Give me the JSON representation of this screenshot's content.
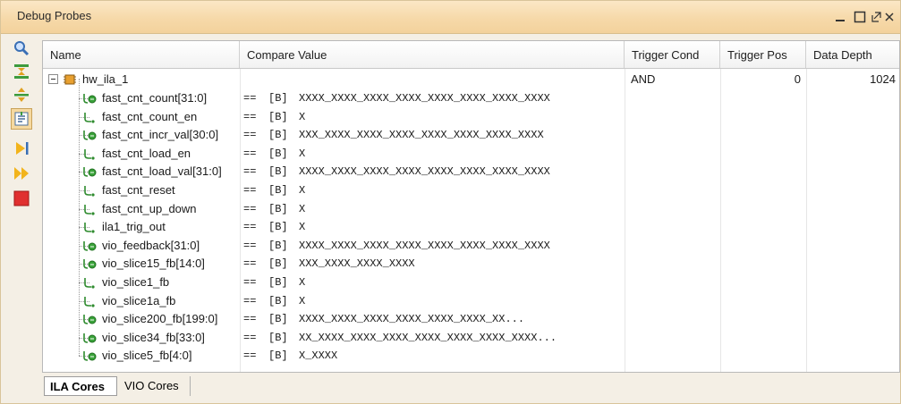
{
  "window": {
    "title": "Debug Probes",
    "controls": [
      "minimize-icon",
      "maximize-icon",
      "restore-icon",
      "close-icon"
    ]
  },
  "toolbar": {
    "buttons": [
      {
        "icon": "search-icon"
      },
      {
        "icon": "collapse-all-icon"
      },
      {
        "icon": "expand-all-icon"
      },
      {
        "icon": "probe-settings-icon",
        "active": true
      },
      {
        "icon": "run-trigger-icon"
      },
      {
        "icon": "run-trigger-immediate-icon"
      },
      {
        "icon": "stop-icon"
      }
    ]
  },
  "table": {
    "columns": [
      "Name",
      "Compare Value",
      "Trigger Cond",
      "Trigger Pos",
      "Data Depth"
    ],
    "core": {
      "name": "hw_ila_1",
      "trigger_cond": "AND",
      "trigger_pos": "0",
      "data_depth": "1024"
    },
    "probes": [
      {
        "name": "fast_cnt_count[31:0]",
        "op": "==",
        "radix": "[B]",
        "value": "XXXX_XXXX_XXXX_XXXX_XXXX_XXXX_XXXX_XXXX",
        "bus": true
      },
      {
        "name": "fast_cnt_count_en",
        "op": "==",
        "radix": "[B]",
        "value": "X",
        "bus": false
      },
      {
        "name": "fast_cnt_incr_val[30:0]",
        "op": "==",
        "radix": "[B]",
        "value": "XXX_XXXX_XXXX_XXXX_XXXX_XXXX_XXXX_XXXX",
        "bus": true
      },
      {
        "name": "fast_cnt_load_en",
        "op": "==",
        "radix": "[B]",
        "value": "X",
        "bus": false
      },
      {
        "name": "fast_cnt_load_val[31:0]",
        "op": "==",
        "radix": "[B]",
        "value": "XXXX_XXXX_XXXX_XXXX_XXXX_XXXX_XXXX_XXXX",
        "bus": true
      },
      {
        "name": "fast_cnt_reset",
        "op": "==",
        "radix": "[B]",
        "value": "X",
        "bus": false
      },
      {
        "name": "fast_cnt_up_down",
        "op": "==",
        "radix": "[B]",
        "value": "X",
        "bus": false
      },
      {
        "name": "ila1_trig_out",
        "op": "==",
        "radix": "[B]",
        "value": "X",
        "bus": false
      },
      {
        "name": "vio_feedback[31:0]",
        "op": "==",
        "radix": "[B]",
        "value": "XXXX_XXXX_XXXX_XXXX_XXXX_XXXX_XXXX_XXXX",
        "bus": true
      },
      {
        "name": "vio_slice15_fb[14:0]",
        "op": "==",
        "radix": "[B]",
        "value": "XXX_XXXX_XXXX_XXXX",
        "bus": true
      },
      {
        "name": "vio_slice1_fb",
        "op": "==",
        "radix": "[B]",
        "value": "X",
        "bus": false
      },
      {
        "name": "vio_slice1a_fb",
        "op": "==",
        "radix": "[B]",
        "value": "X",
        "bus": false
      },
      {
        "name": "vio_slice200_fb[199:0]",
        "op": "==",
        "radix": "[B]",
        "value": "XXXX_XXXX_XXXX_XXXX_XXXX_XXXX_XX...",
        "bus": true
      },
      {
        "name": "vio_slice34_fb[33:0]",
        "op": "==",
        "radix": "[B]",
        "value": "XX_XXXX_XXXX_XXXX_XXXX_XXXX_XXXX_XXXX...",
        "bus": true
      },
      {
        "name": "vio_slice5_fb[4:0]",
        "op": "==",
        "radix": "[B]",
        "value": "X_XXXX",
        "bus": true
      }
    ]
  },
  "tabs": [
    {
      "label": "ILA Cores",
      "selected": true
    },
    {
      "label": "VIO Cores",
      "selected": false
    }
  ],
  "colors": {
    "title_bar": "#f6d9a9",
    "probe_icon": "#3a9a3a",
    "stop": "#e03030"
  }
}
